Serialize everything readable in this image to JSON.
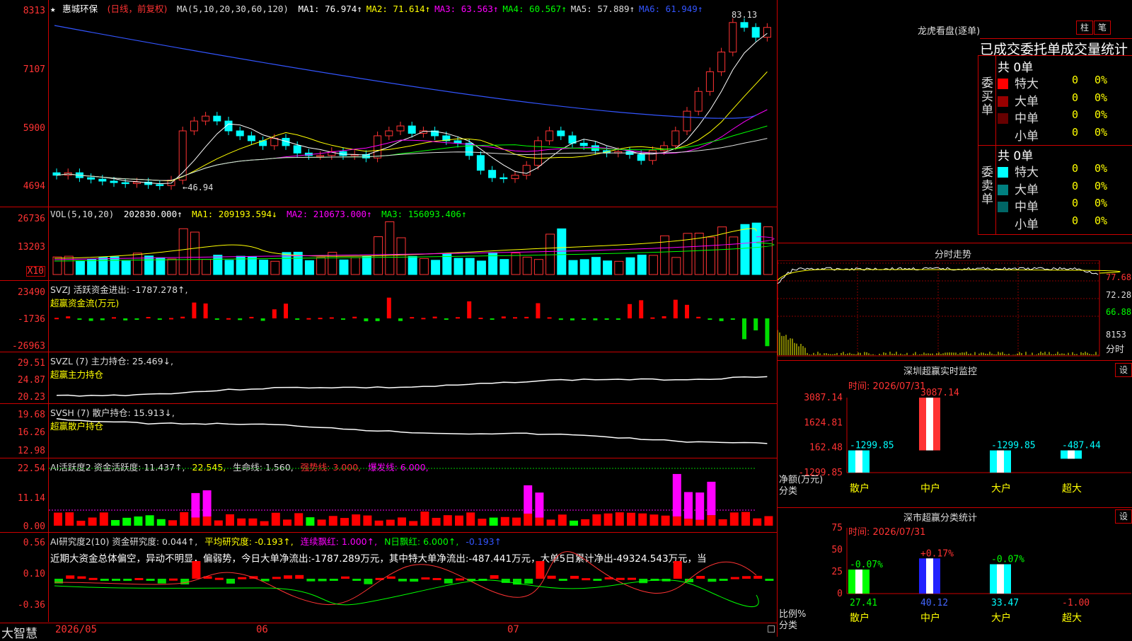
{
  "stock": {
    "title": "惠城环保",
    "mode": "(日线，前复权)",
    "star": "★"
  },
  "main_panel": {
    "y_labels": [
      "8313",
      "7107",
      "5900",
      "4694"
    ],
    "ma_label": "MA(5,10,20,30,60,120)",
    "ma_values": [
      {
        "name": "MA1:",
        "value": "76.974↑",
        "color": "#ffffff"
      },
      {
        "name": "MA2:",
        "value": "71.614↑",
        "color": "#ffff00"
      },
      {
        "name": "MA3:",
        "value": "63.563↑",
        "color": "#ff00ff"
      },
      {
        "name": "MA4:",
        "value": "60.567↑",
        "color": "#00ff00"
      },
      {
        "name": "MA5:",
        "value": "57.889↑",
        "color": "#dddddd"
      },
      {
        "name": "MA6:",
        "value": "61.949↑",
        "color": "#3355ff"
      }
    ],
    "high_label": "83.13",
    "low_label": "←46.94"
  },
  "vol_panel": {
    "y_labels": [
      "26736",
      "13203"
    ],
    "multiplier": "X10",
    "label": "VOL(5,10,20)",
    "value": "202830.000↑",
    "ma": [
      {
        "text": "MA1: 209193.594↓",
        "color": "#ffff00"
      },
      {
        "text": "MA2: 210673.000↑",
        "color": "#ff00ff"
      },
      {
        "text": "MA3: 156093.406↑",
        "color": "#00ff00"
      }
    ]
  },
  "svzj_panel": {
    "y_labels": [
      "23490",
      "-1736",
      "-26963"
    ],
    "label": "SVZJ  活跃资金进出: -1787.278↑,",
    "sub": "超赢资金流(万元)"
  },
  "svzl_panel": {
    "y_labels": [
      "29.51",
      "24.87",
      "20.23"
    ],
    "label": "SVZL (7) 主力持仓: 25.469↓,",
    "sub": "超赢主力持仓"
  },
  "svsh_panel": {
    "y_labels": [
      "19.68",
      "16.26",
      "12.98"
    ],
    "label": "SVSH (7) 散户持仓: 15.913↓,",
    "sub": "超赢散户持仓"
  },
  "ai_active_panel": {
    "y_labels": [
      "22.54",
      "11.14",
      "0.00"
    ],
    "parts": [
      {
        "text": "AI活跃度2 资金活跃度: 11.437↑,",
        "color": "#dddddd"
      },
      {
        "text": "22.545,",
        "color": "#ffff00"
      },
      {
        "text": "生命线: 1.560,",
        "color": "#dddddd"
      },
      {
        "text": "强势线: 3.000,",
        "color": "#ff3333"
      },
      {
        "text": "爆发线: 6.000,",
        "color": "#ff00ff"
      }
    ]
  },
  "ai_research_panel": {
    "y_labels": [
      "0.56",
      "0.10",
      "-0.36"
    ],
    "parts": [
      {
        "text": "AI研究度2(10) 资金研究度: 0.044↑,",
        "color": "#dddddd"
      },
      {
        "text": "平均研究度: -0.193↑,",
        "color": "#ffff00"
      },
      {
        "text": "连续飘红: 1.000↑,",
        "color": "#ff00ff"
      },
      {
        "text": "N日飘红: 6.000↑,",
        "color": "#00ff00"
      },
      {
        "text": "-0.193↑",
        "color": "#3355ff"
      }
    ],
    "comment": "近期大资金总体偏空，异动不明显，偏弱势，今日大单净流出:-1787.289万元，其中特大单净流出:-487.441万元，大单5日累计净出-49324.543万元，当"
  },
  "bottom": {
    "brand": "大智慧",
    "dates": [
      "2026/05",
      "06",
      "07"
    ]
  },
  "longhu": {
    "title": "龙虎看盘(逐单)",
    "btn_bar": "柱",
    "btn_pen": "笔",
    "header": "已成交委托单成交量统计",
    "buy_label": "委买单",
    "sell_label": "委卖单",
    "buy_total": "共 0单",
    "sell_total": "共 0单",
    "buy_rows": [
      {
        "label": "特大",
        "count": "0",
        "pct": "0%",
        "color": "#ff0000"
      },
      {
        "label": "大单",
        "count": "0",
        "pct": "0%",
        "color": "#990000"
      },
      {
        "label": "中单",
        "count": "0",
        "pct": "0%",
        "color": "#660000"
      },
      {
        "label": "小单",
        "count": "0",
        "pct": "0%",
        "color": "#000000"
      }
    ],
    "sell_rows": [
      {
        "label": "特大",
        "count": "0",
        "pct": "0%",
        "color": "#00ffff"
      },
      {
        "label": "大单",
        "count": "0",
        "pct": "0%",
        "color": "#008080"
      },
      {
        "label": "中单",
        "count": "0",
        "pct": "0%",
        "color": "#006666"
      },
      {
        "label": "小单",
        "count": "0",
        "pct": "0%",
        "color": "#000000"
      }
    ]
  },
  "intraday": {
    "title": "分时走势",
    "y_labels": [
      "77.68",
      "72.28",
      "66.88",
      "8153",
      "分时"
    ]
  },
  "monitor": {
    "title": "深圳超赢实时监控",
    "btn": "设",
    "time": "时间: 2026/07/31",
    "y_labels": [
      "3087.14",
      "1624.81",
      "162.48",
      "-1299.85"
    ],
    "unit1": "净额(万元)",
    "unit2": "分类",
    "bars": [
      {
        "cat": "散户",
        "value": -1299.85,
        "label": "-1299.85"
      },
      {
        "cat": "中户",
        "value": 3087.14,
        "label": "3087.14"
      },
      {
        "cat": "大户",
        "value": -1299.85,
        "label": "-1299.85"
      },
      {
        "cat": "超大",
        "value": -487.44,
        "label": "-487.44"
      }
    ]
  },
  "stats": {
    "title": "深市超赢分类统计",
    "btn": "设",
    "time": "时间: 2026/07/31",
    "y_labels": [
      "75",
      "50",
      "25",
      "0"
    ],
    "unit1": "比例%",
    "unit2": "分类",
    "bars": [
      {
        "cat": "散户",
        "value": 27.41,
        "top": "-0.07%",
        "bottom": "27.41"
      },
      {
        "cat": "中户",
        "value": 40.12,
        "top": "+0.17%",
        "bottom": "40.12"
      },
      {
        "cat": "大户",
        "value": 33.47,
        "top": "-0.07%",
        "bottom": "33.47"
      },
      {
        "cat": "超大",
        "value": 0,
        "top": "",
        "bottom": "-1.00"
      }
    ]
  }
}
